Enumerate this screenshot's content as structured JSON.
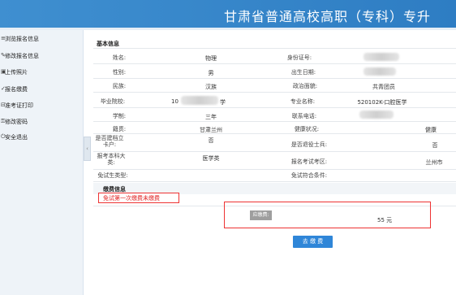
{
  "header": {
    "title": "甘肃省普通高校高职（专科）专升"
  },
  "sidebar": {
    "items": [
      {
        "icon": "≡",
        "label": "浏览报名信息"
      },
      {
        "icon": "✎",
        "label": "修改报名信息"
      },
      {
        "icon": "▣",
        "label": "上传照片"
      },
      {
        "icon": "✓",
        "label": "报名缴费"
      },
      {
        "icon": "⊟",
        "label": "准考证打印"
      },
      {
        "icon": "⚿",
        "label": "修改密码"
      },
      {
        "icon": "⏻",
        "label": "安全退出"
      }
    ]
  },
  "basic": {
    "section_title": "基本信息",
    "name_label": "姓名:",
    "name_value": "物理",
    "id_label": "身份证号:",
    "gender_label": "性别:",
    "gender_value": "男",
    "birth_label": "出生日期:",
    "ethnic_label": "民族:",
    "ethnic_value": "汉族",
    "political_label": "政治面貌:",
    "political_value": "共青团员",
    "school_label": "毕业院校:",
    "school_value_prefix": "10",
    "school_value_suffix": "学",
    "major_label": "专业名称:",
    "major_value": "520102K-口腔医学",
    "years_label": "学制:",
    "years_value": "三年",
    "phone_label": "联系电话:",
    "origin_label": "籍贯:",
    "origin_value": "甘肃兰州",
    "health_label": "健康状况:",
    "health_value": "健康",
    "card_label": "是否建档立卡户:",
    "card_value": "否",
    "soldier_label": "是否退役士兵:",
    "soldier_value": "否",
    "apply_label": "报考本科大类:",
    "apply_value": "医学类",
    "exam_area_label": "报名考试考区:",
    "exam_area_value": "兰州市",
    "exempt_label": "免试生类型:",
    "exempt_cond_label": "免试符合条件:"
  },
  "payment": {
    "section_title": "缴费信息",
    "notice": "免试第一次缴费未缴费",
    "fee_label": "应缴费:",
    "fee_value": "55 元",
    "pay_button": "去 缴 费"
  },
  "colors": {
    "banner": "#2e7dc3",
    "accent_red": "#e02020",
    "button": "#2f86d8"
  }
}
